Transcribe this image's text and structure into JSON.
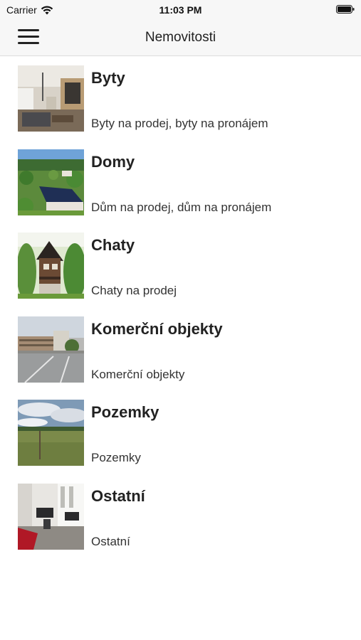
{
  "status": {
    "carrier": "Carrier",
    "time": "11:03 PM"
  },
  "nav": {
    "title": "Nemovitosti"
  },
  "categories": [
    {
      "title": "Byty",
      "subtitle": "Byty na prodej, byty na pronájem",
      "photo": "apartment-interior"
    },
    {
      "title": "Domy",
      "subtitle": "Dům na prodej, dům na pronájem",
      "photo": "village-houses"
    },
    {
      "title": "Chaty",
      "subtitle": "Chaty na prodej",
      "photo": "cottage-in-trees"
    },
    {
      "title": "Komerční objekty",
      "subtitle": "Komerční objekty",
      "photo": "commercial-building"
    },
    {
      "title": "Pozemky",
      "subtitle": "Pozemky",
      "photo": "land-field"
    },
    {
      "title": "Ostatní",
      "subtitle": "Ostatní",
      "photo": "office-room"
    }
  ]
}
